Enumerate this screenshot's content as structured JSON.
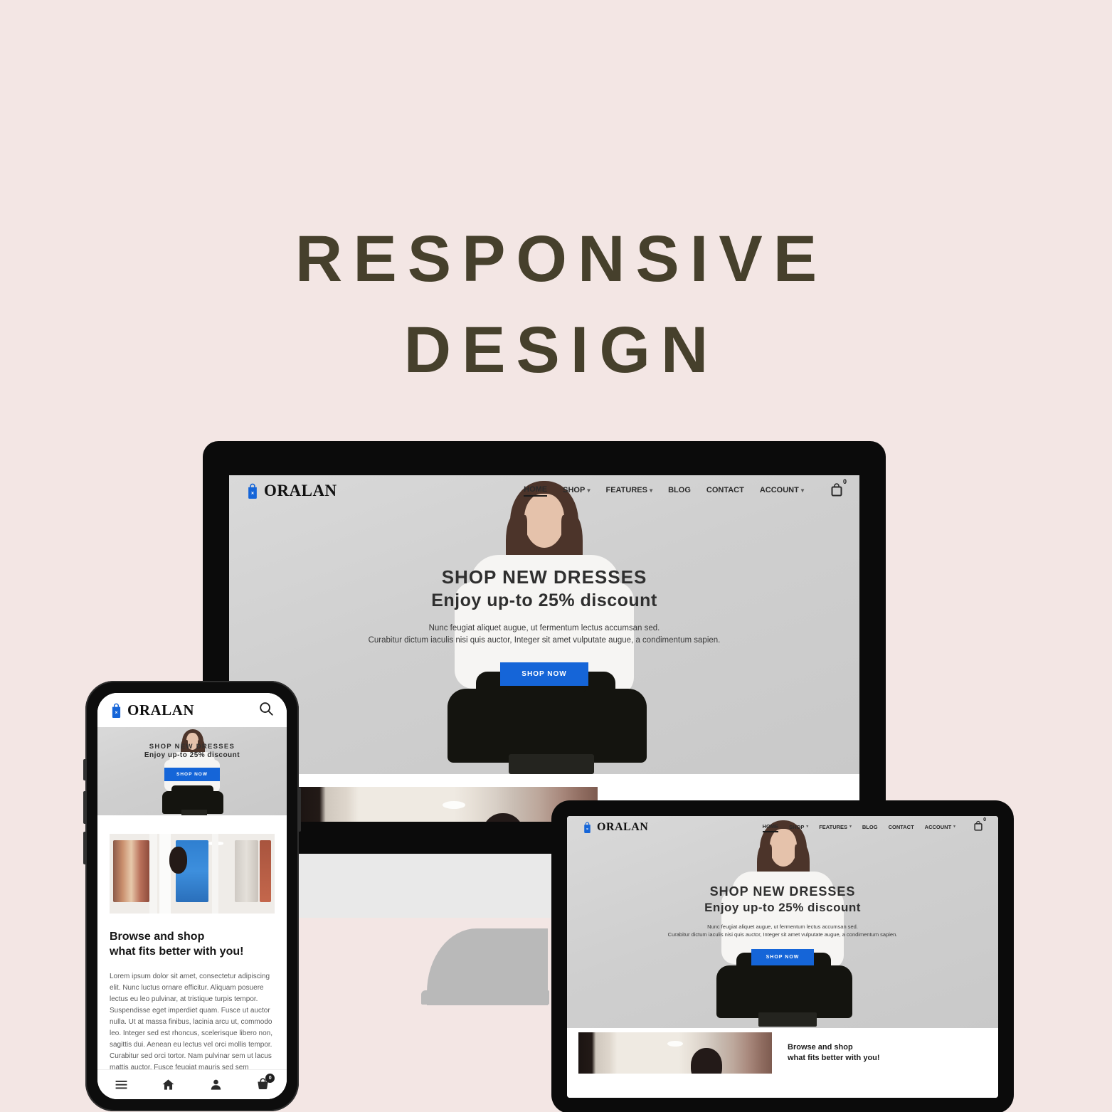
{
  "poster": {
    "title_line1": "RESPONSIVE",
    "title_line2": "DESIGN",
    "background_color": "#f3e6e4",
    "title_color": "#46402c"
  },
  "site": {
    "brand": "ORALAN",
    "brand_icon": "shopping-bag-icon",
    "accent_color": "#1565d8",
    "nav": [
      {
        "label": "HOME",
        "has_dropdown": false,
        "active": true
      },
      {
        "label": "SHOP",
        "has_dropdown": true,
        "active": false
      },
      {
        "label": "FEATURES",
        "has_dropdown": true,
        "active": false
      },
      {
        "label": "BLOG",
        "has_dropdown": false,
        "active": false
      },
      {
        "label": "CONTACT",
        "has_dropdown": false,
        "active": false
      },
      {
        "label": "ACCOUNT",
        "has_dropdown": true,
        "active": false
      }
    ],
    "search_icon": "search-icon",
    "cart_icon": "cart-icon",
    "cart_count": "0",
    "hero": {
      "title": "SHOP NEW DRESSES",
      "subtitle": "Enjoy up-to 25% discount",
      "paragraph_line1": "Nunc feugiat aliquet augue, ut fermentum lectus accumsan sed.",
      "paragraph_line2": "Curabitur dictum iaculis nisi quis auctor, Integer sit amet vulputate augue, a condimentum sapien.",
      "cta": "SHOP NOW"
    },
    "section2": {
      "heading_line1": "Browse and shop",
      "heading_line2": "what fits better with you!",
      "body": "Lorem ipsum dolor sit amet, consectetur adipiscing elit. Nunc luctus ornare efficitur. Aliquam posuere lectus eu leo pulvinar, at tristique turpis tempor. Suspendisse eget imperdiet quam. Fusce ut auctor nulla. Ut at massa finibus, lacinia arcu ut, commodo leo. Integer sed est rhoncus, scelerisque libero non, sagittis dui. Aenean eu lectus vel orci mollis tempor. Curabitur sed orci tortor. Nam pulvinar sem ut lacus mattis auctor. Fusce feugiat mauris sed sem"
    },
    "mobile_tabbar": [
      {
        "icon": "menu-icon",
        "label": ""
      },
      {
        "icon": "home-icon",
        "label": ""
      },
      {
        "icon": "user-icon",
        "label": ""
      },
      {
        "icon": "cart-icon",
        "label": "",
        "badge": "0"
      }
    ]
  },
  "devices": {
    "laptop": "laptop-mockup",
    "tablet": "tablet-mockup",
    "phone": "phone-mockup"
  }
}
